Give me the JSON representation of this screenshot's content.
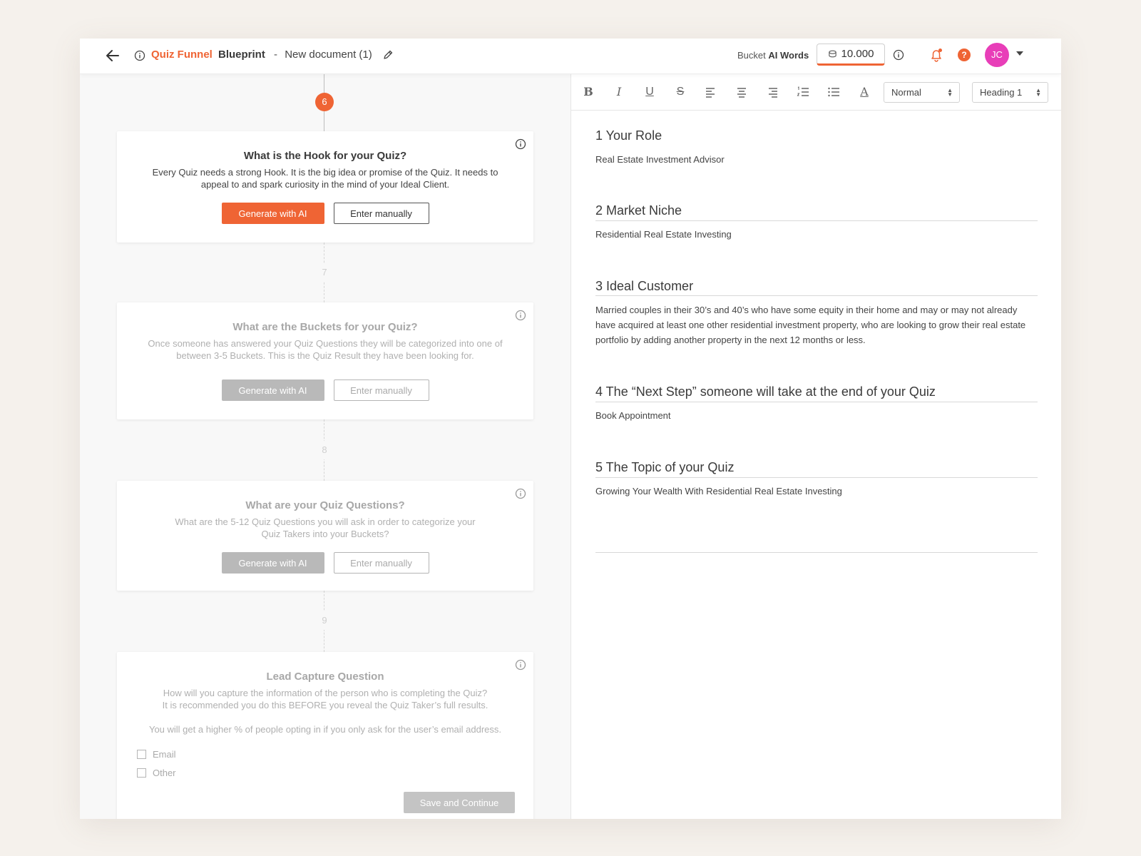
{
  "header": {
    "title_part1": "Quiz Funnel",
    "title_part2": "Blueprint",
    "separator": "-",
    "document_name": "New document (1)",
    "bucket_label_prefix": "Bucket",
    "bucket_label_bold": "AI Words",
    "bucket_value": "10.000",
    "avatar_initials": "JC",
    "help_glyph": "?",
    "icons": [
      "back-arrow-icon",
      "info-icon",
      "pencil-icon",
      "coins-icon",
      "bell-icon",
      "help-icon",
      "chevron-down-icon"
    ],
    "accent_color": "#ef6434",
    "avatar_color": "#e83eb8"
  },
  "steps": {
    "s6": "6",
    "s7": "7",
    "s8": "8",
    "s9": "9"
  },
  "cards": {
    "hook": {
      "title": "What is the Hook for your Quiz?",
      "description": "Every Quiz needs a strong Hook. It is the big idea or promise of the Quiz. It needs to appeal to and spark curiosity in the mind of your Ideal Client.",
      "generate_label": "Generate with AI",
      "manual_label": "Enter manually"
    },
    "buckets": {
      "title": "What are the Buckets for your Quiz?",
      "description": "Once someone has answered your Quiz Questions they will be categorized into one of between 3-5 Buckets. This is the Quiz Result they have been looking for.",
      "generate_label": "Generate with AI",
      "manual_label": "Enter manually"
    },
    "questions": {
      "title": "What are your Quiz Questions?",
      "description": "What are the 5-12 Quiz Questions you will ask in order to categorize your Quiz Takers into your Buckets?",
      "generate_label": "Generate with AI",
      "manual_label": "Enter manually"
    },
    "lead": {
      "title": "Lead Capture Question",
      "description_line1": "How will you capture the information of the person who is completing the Quiz?",
      "description_line2": "It is recommended you do this BEFORE you reveal the Quiz Taker’s full results.",
      "note": "You will get a higher % of people opting in if you only ask for the user’s email address.",
      "option_email": "Email",
      "option_other": "Other",
      "save_label": "Save and Continue"
    }
  },
  "editor": {
    "toolbar": {
      "bold": "B",
      "italic": "I",
      "underline": "U",
      "strike": "S",
      "font_color": "A",
      "style_select": "Normal",
      "heading_select": "Heading 1"
    },
    "sections": [
      {
        "heading": "1 Your Role",
        "value": "Real Estate Investment Advisor"
      },
      {
        "heading": "2 Market Niche",
        "value": "Residential Real Estate Investing"
      },
      {
        "heading": "3 Ideal Customer",
        "value": "Married couples in their 30’s and 40’s who have some equity in their home and may or may not already have acquired at least one other residential investment property, who are looking to grow their real estate portfolio by adding another property in the next 12 months or less."
      },
      {
        "heading": "4  The “Next Step” someone will take at the end of your Quiz",
        "value": "Book Appointment"
      },
      {
        "heading": "5 The Topic of your Quiz",
        "value": "Growing Your Wealth With Residential Real Estate Investing"
      }
    ]
  }
}
